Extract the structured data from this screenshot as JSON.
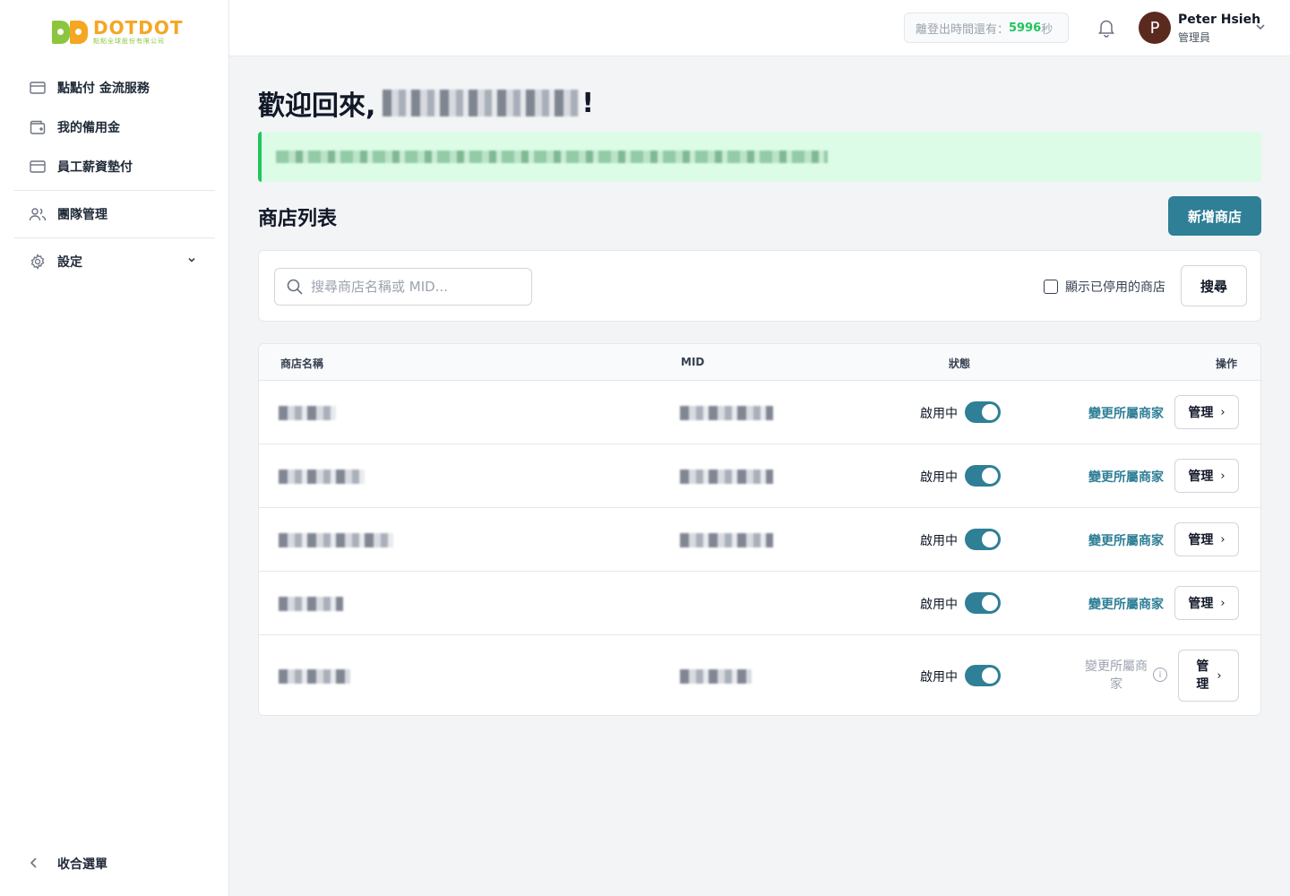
{
  "brand": {
    "name": "DOTDOT",
    "subtitle": "點點全球股份有限公司",
    "colors": {
      "green": "#8cc63f",
      "orange": "#f5a623",
      "accent": "#2f7f96",
      "success": "#22c55e"
    }
  },
  "sidebar": {
    "items": [
      {
        "label": "點點付 金流服務",
        "icon": "credit-card-icon"
      },
      {
        "label": "我的備用金",
        "icon": "wallet-icon"
      },
      {
        "label": "員工薪資墊付",
        "icon": "credit-card-icon"
      },
      {
        "label": "團隊管理",
        "icon": "users-icon"
      },
      {
        "label": "設定",
        "icon": "gear-icon"
      }
    ],
    "collapse_label": "收合選單"
  },
  "header": {
    "timer_prefix": "離登出時間還有：",
    "timer_value": "5996",
    "timer_suffix": "秒",
    "user_initial": "P",
    "user_name": "Peter Hsieh",
    "user_role": "管理員"
  },
  "main": {
    "welcome_prefix": "歡迎回來,",
    "welcome_suffix": "!",
    "section_title": "商店列表",
    "add_button": "新增商店",
    "search_placeholder": "搜尋商店名稱或 MID...",
    "show_disabled_label": "顯示已停用的商店",
    "search_button": "搜尋"
  },
  "table": {
    "headers": {
      "name": "商店名稱",
      "mid": "MID",
      "status": "狀態",
      "action": "操作"
    },
    "rows": [
      {
        "status": "啟用中",
        "change": "變更所屬商家",
        "manage": "管理"
      },
      {
        "status": "啟用中",
        "change": "變更所屬商家",
        "manage": "管理"
      },
      {
        "status": "啟用中",
        "change": "變更所屬商家",
        "manage": "管理"
      },
      {
        "status": "啟用中",
        "change": "變更所屬商家",
        "manage": "管理"
      },
      {
        "status": "啟用中",
        "change": "變更所屬商家",
        "manage": "管理"
      }
    ]
  }
}
